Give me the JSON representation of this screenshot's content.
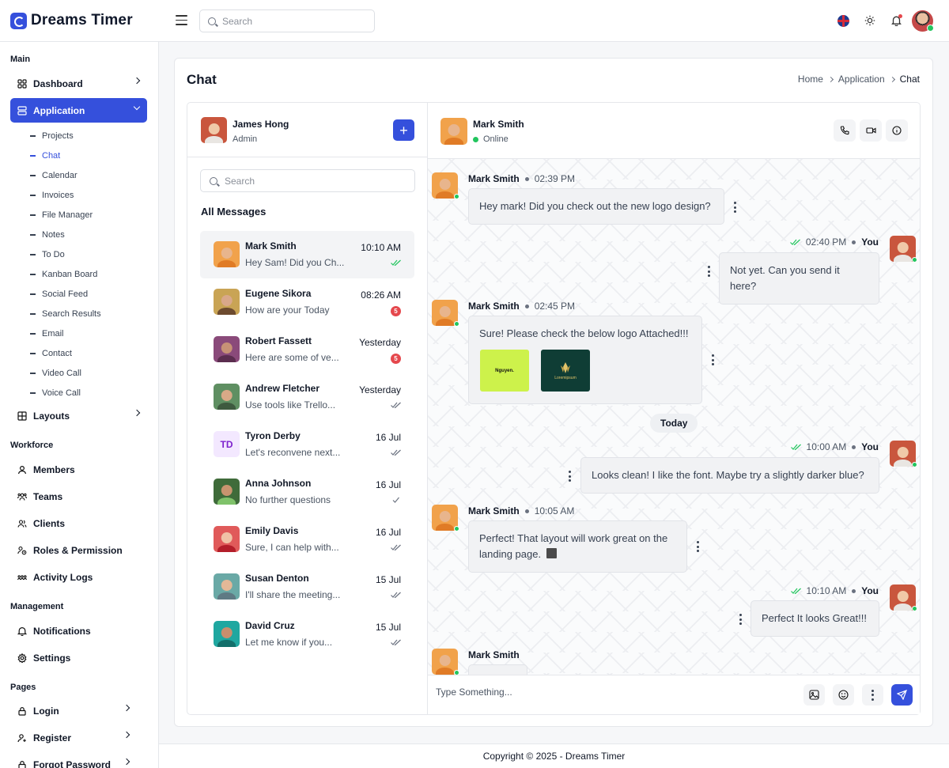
{
  "app": {
    "name": "Dreams Timer"
  },
  "topbar": {
    "search_placeholder": "Search"
  },
  "sidebar": {
    "sections": {
      "main": "Main",
      "workforce": "Workforce",
      "management": "Management",
      "pages": "Pages"
    },
    "dashboard": "Dashboard",
    "application": "Application",
    "app_sub": [
      "Projects",
      "Chat",
      "Calendar",
      "Invoices",
      "File Manager",
      "Notes",
      "To Do",
      "Kanban Board",
      "Social Feed",
      "Search Results",
      "Email",
      "Contact",
      "Video Call",
      "Voice Call"
    ],
    "layouts": "Layouts",
    "workforce": [
      "Members",
      "Teams",
      "Clients",
      "Roles & Permission",
      "Activity Logs"
    ],
    "management": [
      "Notifications",
      "Settings"
    ],
    "pages": [
      "Login",
      "Register",
      "Forgot Password"
    ]
  },
  "page": {
    "title": "Chat",
    "breadcrumb": [
      "Home",
      "Application",
      "Chat"
    ]
  },
  "me": {
    "name": "James Hong",
    "role": "Admin"
  },
  "list": {
    "search_placeholder": "Search",
    "heading": "All Messages",
    "conversations": [
      {
        "name": "Mark Smith",
        "preview": "Hey Sam! Did you Ch...",
        "time": "10:10 AM",
        "status": "read"
      },
      {
        "name": "Eugene Sikora",
        "preview": "How are your Today",
        "time": "08:26 AM",
        "badge": "5"
      },
      {
        "name": "Robert Fassett",
        "preview": "Here are some of ve...",
        "time": "Yesterday",
        "badge": "5"
      },
      {
        "name": "Andrew Fletcher",
        "preview": "Use tools like Trello...",
        "time": "Yesterday",
        "status": "delivered"
      },
      {
        "name": "Tyron Derby",
        "initials": "TD",
        "preview": "Let's reconvene next...",
        "time": "16 Jul",
        "status": "delivered"
      },
      {
        "name": "Anna Johnson",
        "preview": "No further questions",
        "time": "16 Jul",
        "status": "sent"
      },
      {
        "name": "Emily Davis",
        "preview": "Sure, I can help with...",
        "time": "16 Jul",
        "status": "delivered"
      },
      {
        "name": "Susan Denton",
        "preview": "I'll share the meeting...",
        "time": "15 Jul",
        "status": "delivered"
      },
      {
        "name": "David Cruz",
        "preview": "Let me know if you...",
        "time": "15 Jul",
        "status": "delivered"
      }
    ]
  },
  "chat": {
    "contact": {
      "name": "Mark Smith",
      "status": "Online"
    },
    "day_divider": "Today",
    "messages": [
      {
        "from": "Mark Smith",
        "time": "02:39 PM",
        "text": "Hey mark! Did you check out the new logo design?"
      },
      {
        "from": "You",
        "time": "02:40 PM",
        "text": "Not yet. Can you send it here?"
      },
      {
        "from": "Mark Smith",
        "time": "02:45 PM",
        "text": "Sure! Please check the below logo Attached!!!",
        "attachments": [
          "Nguyen.",
          "Loremipsum"
        ]
      },
      {
        "from": "You",
        "time": "10:00 AM",
        "text": "Looks clean! I like the font. Maybe try a slightly darker blue?"
      },
      {
        "from": "Mark Smith",
        "time": "10:05 AM",
        "text": "Perfect! That layout will work great on the landing page."
      },
      {
        "from": "You",
        "time": "10:10 AM",
        "text": "Perfect It looks Great!!!"
      },
      {
        "from": "Mark Smith",
        "time": "",
        "text": ""
      }
    ],
    "composer_placeholder": "Type Something..."
  },
  "footer": {
    "text": "Copyright © 2025 - Dreams Timer"
  },
  "colors": {
    "primary": "#3550dc",
    "online": "#22c55e",
    "badge": "#e5484d",
    "tick": "#22c55e"
  }
}
